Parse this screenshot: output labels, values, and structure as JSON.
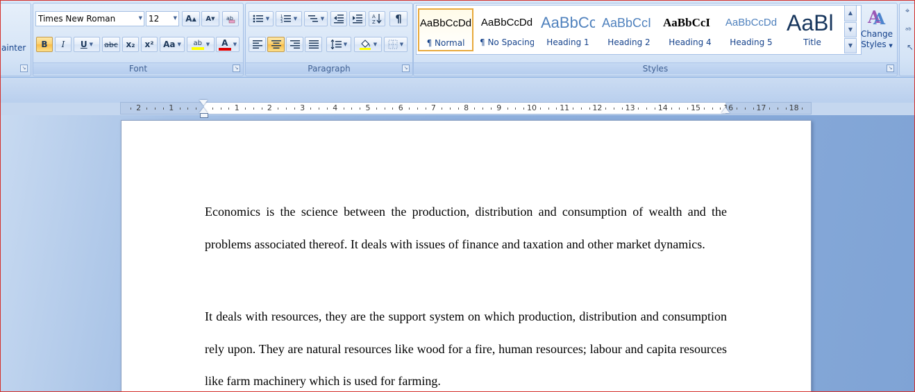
{
  "clipboard": {
    "format_painter_label": "ainter"
  },
  "font": {
    "group_label": "Font",
    "name": "Times New Roman",
    "size": "12",
    "grow_label": "A",
    "shrink_label": "A",
    "bold": "B",
    "italic": "I",
    "underline": "U",
    "strike": "abc",
    "subscript": "x₂",
    "superscript": "x²",
    "change_case": "Aa",
    "highlight": "ab",
    "font_color": "A",
    "highlight_color": "#ffff00",
    "font_color_value": "#e00000"
  },
  "paragraph": {
    "group_label": "Paragraph",
    "show_marks": "¶"
  },
  "styles": {
    "group_label": "Styles",
    "items": [
      {
        "sample": "AaBbCcDd",
        "name": "¶ Normal"
      },
      {
        "sample": "AaBbCcDd",
        "name": "¶ No Spacing"
      },
      {
        "sample": "AaBbCc",
        "name": "Heading 1"
      },
      {
        "sample": "AaBbCcI",
        "name": "Heading 2"
      },
      {
        "sample": "AaBbCcI",
        "name": "Heading 4"
      },
      {
        "sample": "AaBbCcDd",
        "name": "Heading 5"
      },
      {
        "sample": "AaBl",
        "name": "Title"
      }
    ],
    "change_styles_line1": "Change",
    "change_styles_line2": "Styles"
  },
  "ruler": {
    "left_numbers": [
      "2",
      "1"
    ],
    "right_numbers": [
      "1",
      "2",
      "3",
      "4",
      "5",
      "6",
      "7",
      "8",
      "9",
      "10",
      "11",
      "12",
      "13",
      "14",
      "15",
      "16",
      "17",
      "18"
    ]
  },
  "document": {
    "paragraphs": [
      "Economics is the science between the production, distribution and consumption of wealth and the problems associated thereof. It deals with issues of finance and taxation and other market dynamics.",
      "It deals with resources, they are the support system on which production, distribution and consumption rely upon. They are natural resources like wood for a fire, human resources; labour and capita resources like farm machinery which is used for farming."
    ]
  },
  "colors": {
    "accent": "#15428b",
    "ribbon": "#cfdff5",
    "active_border": "#e8a93b"
  }
}
